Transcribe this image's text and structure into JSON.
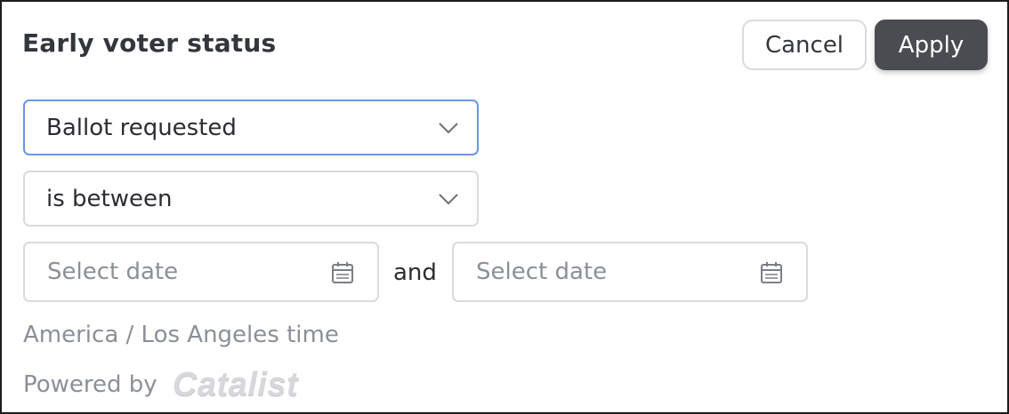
{
  "dialog": {
    "title": "Early voter status",
    "cancel_label": "Cancel",
    "apply_label": "Apply"
  },
  "filter": {
    "field_value": "Ballot requested",
    "operator_value": "is between",
    "date_start_placeholder": "Select date",
    "date_end_placeholder": "Select date",
    "connector": "and",
    "timezone": "America / Los Angeles time"
  },
  "footer": {
    "powered_by": "Powered by",
    "brand": "Catalist"
  },
  "icons": {
    "dropdown": "chevron-down-icon",
    "date": "calendar-icon"
  },
  "colors": {
    "apply_bg": "#4a4c52",
    "focus_border": "#6d95e3",
    "muted_text": "#8b8f98",
    "border": "#d9dadd"
  }
}
